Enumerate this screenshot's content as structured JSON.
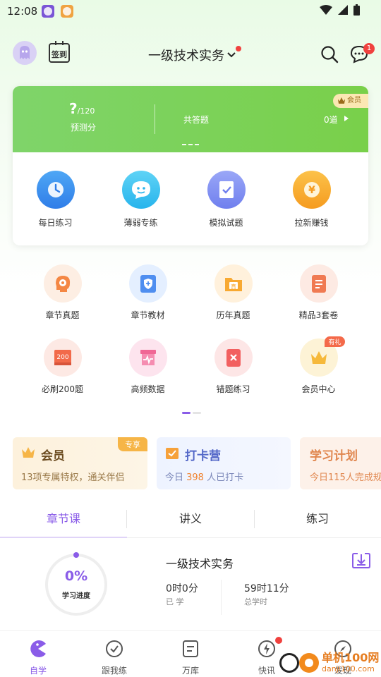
{
  "status_bar": {
    "time": "12:08"
  },
  "header": {
    "checkin_label": "签到",
    "subject": "一级技术实务",
    "message_count": "1"
  },
  "stats_card": {
    "predicted_score": "?",
    "predicted_total": "/120",
    "predicted_label": "预测分",
    "total_label": "共答题",
    "total_value": "0道",
    "vip_tag": "会员"
  },
  "features": [
    {
      "label": "每日练习",
      "icon": "clock-icon"
    },
    {
      "label": "薄弱专练",
      "icon": "chat-face-icon"
    },
    {
      "label": "模拟试题",
      "icon": "test-paper-icon"
    },
    {
      "label": "拉新赚钱",
      "icon": "yen-coin-icon"
    }
  ],
  "grid": [
    {
      "label": "章节真题",
      "icon": "brain-gear-icon"
    },
    {
      "label": "章节教材",
      "icon": "shield-plus-icon"
    },
    {
      "label": "历年真题",
      "icon": "folder-zhen-icon"
    },
    {
      "label": "精品3套卷",
      "icon": "document-icon"
    },
    {
      "label": "必刷200题",
      "icon": "book-200-icon"
    },
    {
      "label": "高频数据",
      "icon": "heartbeat-chart-icon"
    },
    {
      "label": "错题练习",
      "icon": "error-book-icon"
    },
    {
      "label": "会员中心",
      "icon": "crown-icon",
      "badge": "有礼"
    }
  ],
  "promos": {
    "vip": {
      "title": "会员",
      "subtitle": "13项专属特权，通关伴侣",
      "tag": "专享"
    },
    "clock_in": {
      "title": "打卡营",
      "sub_prefix": "今日 ",
      "count": "398",
      "sub_suffix": " 人已打卡"
    },
    "plan": {
      "title": "学习计划",
      "subtitle": "今日115人完成规"
    }
  },
  "tabs": [
    "章节课",
    "讲义",
    "练习"
  ],
  "progress": {
    "percent": "0%",
    "percent_value": 0,
    "label": "学习进度",
    "course": "一级技术实务",
    "learned_value": "0时0分",
    "learned_label": "已 学",
    "total_value": "59时11分",
    "total_label": "总学时"
  },
  "bottom_nav": [
    {
      "label": "自学",
      "icon": "pacman-icon"
    },
    {
      "label": "跟我练",
      "icon": "check-circle-icon"
    },
    {
      "label": "万库",
      "icon": "library-icon"
    },
    {
      "label": "快讯",
      "icon": "lightning-icon"
    },
    {
      "label": "发现",
      "icon": "compass-icon"
    }
  ],
  "watermark": {
    "line1": "单机100网",
    "line2": "danji100.com"
  },
  "colors": {
    "accent": "#8a5ce8",
    "green": "#79d04a",
    "badge_red": "#f0413e"
  }
}
